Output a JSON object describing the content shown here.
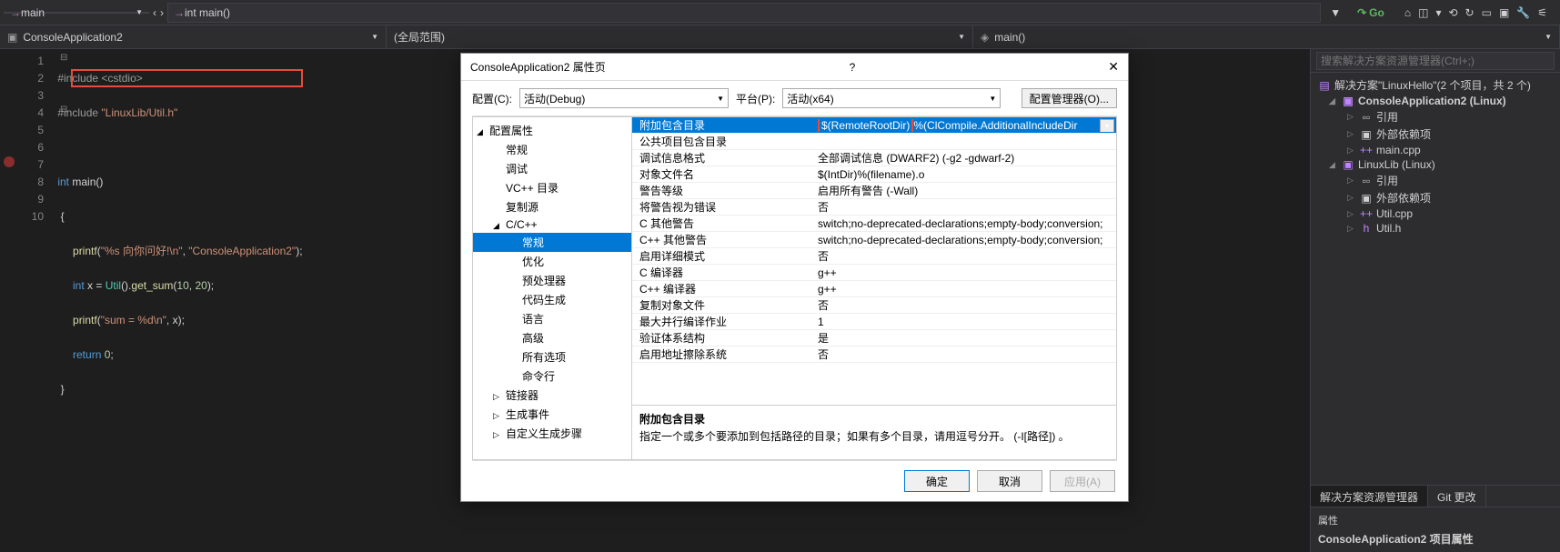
{
  "topbar": {
    "scope_main": "main",
    "func_dropdown": "int main()",
    "go_label": "Go"
  },
  "scopebar": {
    "file_tab": "ConsoleApplication2",
    "scope_global": "(全局范围)",
    "scope_func": "main()"
  },
  "code": {
    "lines": [
      "1",
      "2",
      "3",
      "4",
      "5",
      "6",
      "7",
      "8",
      "9",
      "10"
    ],
    "l1_pp": "#include",
    "l1_inc": " <cstdio>",
    "l2_pp": "#include",
    "l2_inc": " \"LinuxLib/Util.h\"",
    "l4_type": "int",
    "l4_fn": " main()",
    "l5": "{",
    "l6_fn": "printf",
    "l6_a": "(",
    "l6_s1": "\"%s 向你问好!\\n\"",
    "l6_b": ", ",
    "l6_s2": "\"ConsoleApplication2\"",
    "l6_c": ")",
    "l7_kw": "int",
    "l7_a": " x = ",
    "l7_cls": "Util",
    "l7_b": "().",
    "l7_fn": "get_sum",
    "l7_c": "(",
    "l7_n1": "10",
    "l7_d": ", ",
    "l7_n2": "20",
    "l7_e": ");",
    "l8_fn": "printf",
    "l8_a": "(",
    "l8_s": "\"sum = %d\\n\"",
    "l8_b": ", x);",
    "l9_kw": "return",
    "l9_a": " ",
    "l9_n": "0",
    "l9_b": ";",
    "l10": "}"
  },
  "dialog": {
    "title": "ConsoleApplication2 属性页",
    "config_label": "配置(C):",
    "config_value": "活动(Debug)",
    "platform_label": "平台(P):",
    "platform_value": "活动(x64)",
    "config_mgr": "配置管理器(O)...",
    "tree": {
      "root": "配置属性",
      "general": "常规",
      "debug": "调试",
      "vc_dirs": "VC++ 目录",
      "copy_src": "复制源",
      "cc": "C/C++",
      "cc_general": "常规",
      "cc_opt": "优化",
      "cc_pp": "预处理器",
      "cc_codegen": "代码生成",
      "cc_lang": "语言",
      "cc_adv": "高级",
      "cc_all": "所有选项",
      "cc_cmd": "命令行",
      "linker": "链接器",
      "build_events": "生成事件",
      "custom_build": "自定义生成步骤"
    },
    "props": [
      {
        "name": "附加包含目录",
        "val_hl": "$(RemoteRootDir)",
        "val_rest": "%(ClCompile.AdditionalIncludeDir",
        "selected": true,
        "dd": true
      },
      {
        "name": "公共项目包含目录",
        "val": ""
      },
      {
        "name": "调试信息格式",
        "val": "全部调试信息 (DWARF2) (-g2 -gdwarf-2)"
      },
      {
        "name": "对象文件名",
        "val": "$(IntDir)%(filename).o"
      },
      {
        "name": "警告等级",
        "val": "启用所有警告 (-Wall)"
      },
      {
        "name": "将警告视为错误",
        "val": "否"
      },
      {
        "name": "C 其他警告",
        "val": "switch;no-deprecated-declarations;empty-body;conversion;"
      },
      {
        "name": "C++ 其他警告",
        "val": "switch;no-deprecated-declarations;empty-body;conversion;"
      },
      {
        "name": "启用详细模式",
        "val": "否"
      },
      {
        "name": "C 编译器",
        "val": "g++"
      },
      {
        "name": "C++ 编译器",
        "val": "g++"
      },
      {
        "name": "复制对象文件",
        "val": "否"
      },
      {
        "name": "最大并行编译作业",
        "val": "1"
      },
      {
        "name": "验证体系结构",
        "val": "是"
      },
      {
        "name": "启用地址擦除系统",
        "val": "否"
      }
    ],
    "desc_title": "附加包含目录",
    "desc_body": "指定一个或多个要添加到包括路径的目录；如果有多个目录，请用逗号分开。 (-I[路径]) 。",
    "btn_ok": "确定",
    "btn_cancel": "取消",
    "btn_apply": "应用(A)"
  },
  "explorer": {
    "search_placeholder": "搜索解决方案资源管理器(Ctrl+;)",
    "solution": "解决方案\"LinuxHello\"(2 个项目，共 2 个)",
    "proj1": "ConsoleApplication2 (Linux)",
    "refs": "引用",
    "ext_deps": "外部依赖项",
    "main_cpp": "main.cpp",
    "proj2": "LinuxLib (Linux)",
    "util_cpp": "Util.cpp",
    "util_h": "Util.h",
    "tab_sln": "解决方案资源管理器",
    "tab_git": "Git 更改",
    "props_title": "属性",
    "props_sub": "ConsoleApplication2 项目属性"
  }
}
